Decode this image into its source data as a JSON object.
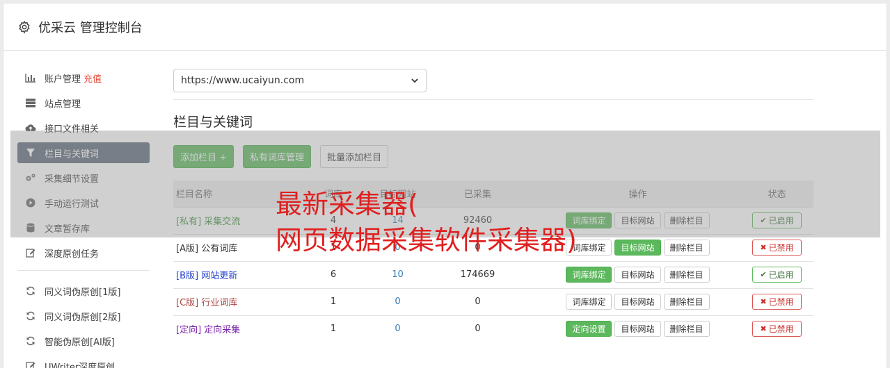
{
  "header": {
    "title": "优采云 管理控制台",
    "icon": "gear-icon"
  },
  "sidebar": {
    "group1": [
      {
        "label": "账户管理",
        "extra": "充值",
        "icon": "bar-chart-icon"
      },
      {
        "label": "站点管理",
        "icon": "server-icon"
      },
      {
        "label": "接口文件相关",
        "icon": "cloud-upload-icon"
      },
      {
        "label": "栏目与关键词",
        "icon": "filter-icon",
        "active": true
      },
      {
        "label": "采集细节设置",
        "icon": "cogs-icon"
      },
      {
        "label": "手动运行测试",
        "icon": "play-circle-icon"
      },
      {
        "label": "文章暂存库",
        "icon": "database-icon"
      },
      {
        "label": "深度原创任务",
        "icon": "edit-icon"
      }
    ],
    "group2": [
      {
        "label": "同义词伪原创[1版]",
        "icon": "refresh-icon"
      },
      {
        "label": "同义词伪原创[2版]",
        "icon": "refresh-icon"
      },
      {
        "label": "智能伪原创[AI版]",
        "icon": "refresh-icon"
      },
      {
        "label": "UWriter深度原创",
        "icon": "edit-icon"
      }
    ]
  },
  "main": {
    "site_select": "https://www.ucaiyun.com",
    "section_title": "栏目与关键词",
    "buttons": {
      "add": "添加栏目 +",
      "private_lib": "私有词库管理",
      "batch_add": "批量添加栏目"
    },
    "table": {
      "headers": [
        "栏目名称",
        "词库",
        "目标网站",
        "已采集",
        "操作",
        "状态"
      ],
      "rows": [
        {
          "tag": "[私有]",
          "name": "采集交流",
          "words": "4",
          "targets": "14",
          "collected": "92460",
          "op1": "词库绑定",
          "op2": "目标网站",
          "op3": "删除栏目",
          "status": "已启用",
          "on": true,
          "color": "#3c8d3c",
          "op1_green": true,
          "op2_green": false
        },
        {
          "tag": "[A版]",
          "name": "公有词库",
          "words": "1",
          "targets": "0",
          "collected": "0",
          "op1": "词库绑定",
          "op2": "目标网站",
          "op3": "删除栏目",
          "status": "已禁用",
          "on": false,
          "color": "#333333",
          "op1_green": false,
          "op2_green": true
        },
        {
          "tag": "[B版]",
          "name": "网站更新",
          "words": "6",
          "targets": "10",
          "collected": "174669",
          "op1": "词库绑定",
          "op2": "目标网站",
          "op3": "删除栏目",
          "status": "已启用",
          "on": true,
          "color": "#1f3fcf",
          "op1_green": true,
          "op2_green": false
        },
        {
          "tag": "[C版]",
          "name": "行业词库",
          "words": "1",
          "targets": "0",
          "collected": "0",
          "op1": "词库绑定",
          "op2": "目标网站",
          "op3": "删除栏目",
          "status": "已禁用",
          "on": false,
          "color": "#a94442",
          "op1_green": false,
          "op2_green": false
        },
        {
          "tag": "[定向]",
          "name": "定向采集",
          "words": "1",
          "targets": "0",
          "collected": "0",
          "op1": "定向设置",
          "op2": "目标网站",
          "op3": "删除栏目",
          "status": "已禁用",
          "on": false,
          "color": "#7a1fa8",
          "op1_green": true,
          "op2_green": false
        }
      ]
    }
  },
  "overlay_text": {
    "line1": "最新采集器(",
    "line2": "网页数据采集软件采集器)"
  }
}
